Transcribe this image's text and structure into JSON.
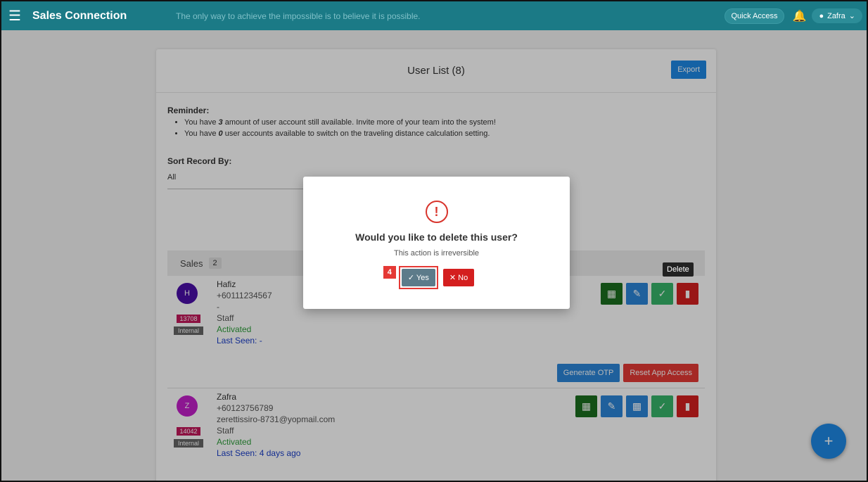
{
  "topbar": {
    "app_title": "Sales Connection",
    "quote": "The only way to achieve the impossible is to believe it is possible.",
    "quick_access": "Quick Access",
    "user_name": "Zafra",
    "icons": {
      "menu": "hamburger-icon",
      "bell": "bell-icon",
      "user": "user-icon",
      "chevron": "chevron-down-icon"
    }
  },
  "card": {
    "title": "User List (8)",
    "export_label": "Export",
    "reminder_title": "Reminder:",
    "reminder_1a": "You have ",
    "reminder_1b": "3",
    "reminder_1c": " amount of user account still available. Invite more of your team into the system!",
    "reminder_2a": "You have ",
    "reminder_2b": "0",
    "reminder_2c": " user accounts available to switch on the traveling distance calculation setting.",
    "sort_label": "Sort Record By:",
    "sort_value": "All"
  },
  "group": {
    "name": "Sales",
    "count": "2"
  },
  "users": [
    {
      "initial": "H",
      "avatar_color": "#4a0fa8",
      "id": "13708",
      "type": "Internal",
      "name": "Hafiz",
      "phone": "+60111234567",
      "email": "-",
      "role": "Staff",
      "status": "Activated",
      "last_seen": "Last Seen: -"
    },
    {
      "initial": "Z",
      "avatar_color": "#c21fc9",
      "id": "14042",
      "type": "Internal",
      "name": "Zafra",
      "phone": "+60123756789",
      "email": "zerettissiro-8731@yopmail.com",
      "role": "Staff",
      "status": "Activated",
      "last_seen": "Last Seen: 4 days ago"
    }
  ],
  "row_buttons": {
    "generate_otp": "Generate OTP",
    "reset_app_access": "Reset App Access"
  },
  "tooltip": "Delete",
  "modal": {
    "title": "Would you like to delete this user?",
    "subtitle": "This action is irreversible",
    "yes_label": "Yes",
    "no_label": "No",
    "step_number": "4",
    "icon": "exclamation-icon"
  },
  "colors": {
    "topbar": "#1b7a86",
    "primary": "#1e88e5",
    "danger": "#d41f1f",
    "success": "#37b56a"
  }
}
